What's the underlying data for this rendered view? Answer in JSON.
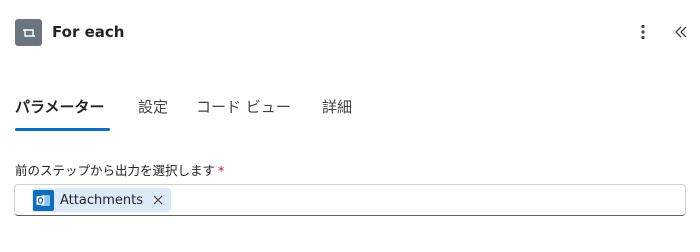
{
  "header": {
    "title": "For each",
    "icons": {
      "action": "foreach-icon",
      "more": "more-vertical-icon",
      "collapse": "double-chevron-left-icon"
    }
  },
  "tabs": [
    {
      "label": "パラメーター",
      "active": true
    },
    {
      "label": "設定",
      "active": false
    },
    {
      "label": "コード ビュー",
      "active": false
    },
    {
      "label": "詳細",
      "active": false
    }
  ],
  "field": {
    "label": "前のステップから出力を選択します",
    "required_mark": "*",
    "token": {
      "label": "Attachments",
      "icon": "outlook-icon"
    }
  },
  "colors": {
    "accent": "#0f6cbd",
    "token_bg": "#dce9f7",
    "action_icon_bg": "#6b7582",
    "required": "#c50f1f"
  }
}
